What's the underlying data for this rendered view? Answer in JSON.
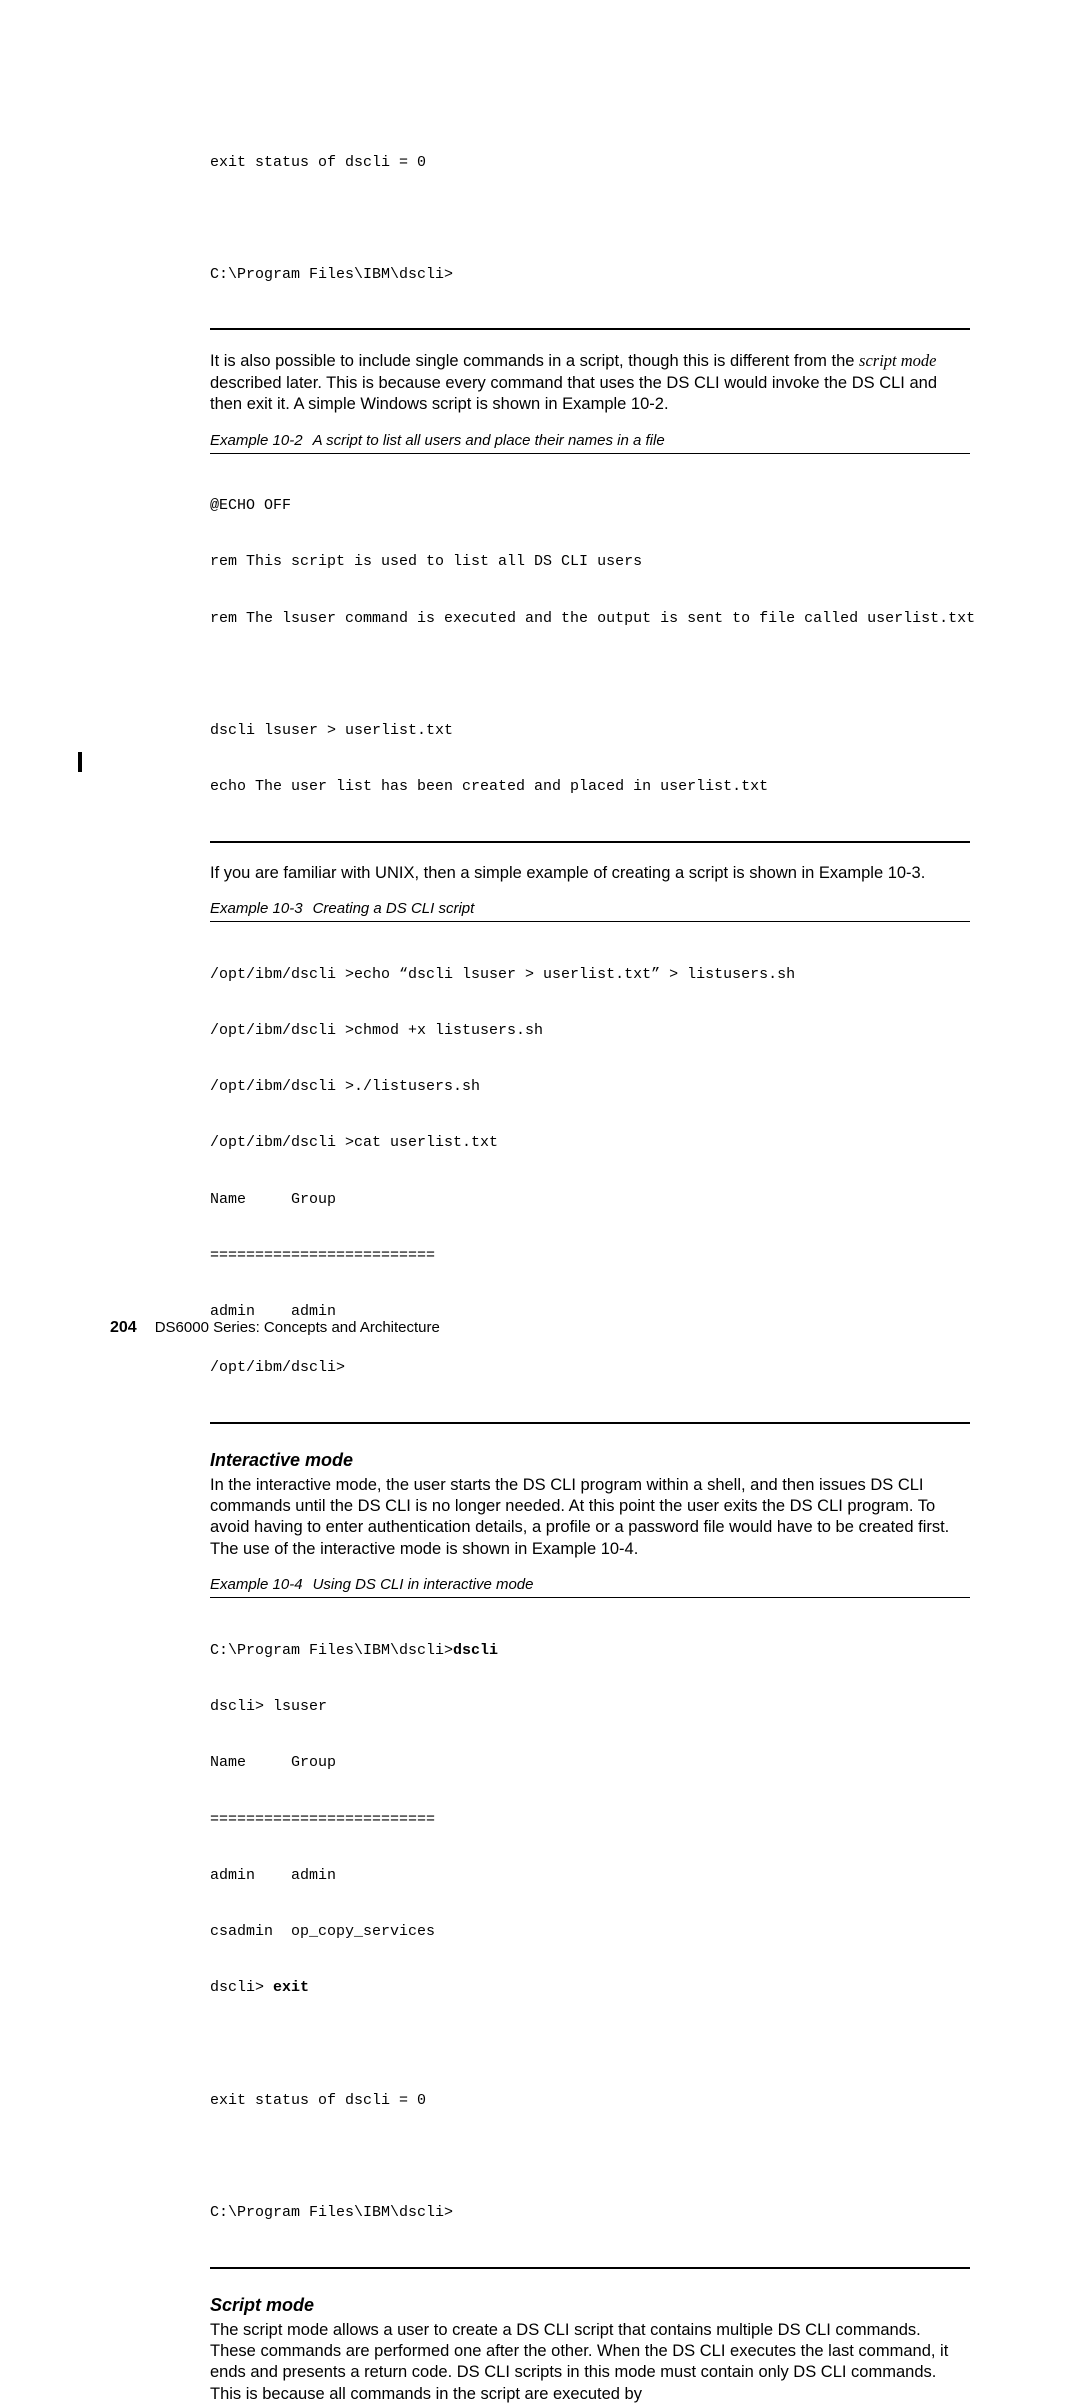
{
  "top_code": {
    "line1": "exit status of dscli = 0",
    "line2": "C:\\Program Files\\IBM\\dscli>"
  },
  "para1": {
    "pre": "It is also possible to include single commands in a script, though this is different from the ",
    "italic": "script mode",
    "post": " described later. This is because every command that uses the DS CLI would invoke the DS CLI and then exit it. A simple Windows script is shown in Example 10-2."
  },
  "ex2": {
    "num": "Example 10-2",
    "title": "A script to list all users and place their names in a file",
    "l1": "@ECHO OFF",
    "l2": "rem This script is used to list all DS CLI users",
    "l3": "rem The lsuser command is executed and the output is sent to file called userlist.txt",
    "l4": "dscli lsuser > userlist.txt",
    "l5": "echo The user list has been created and placed in userlist.txt"
  },
  "para2": "If you are familiar with UNIX, then a simple example of creating a script is shown in Example 10-3.",
  "ex3": {
    "num": "Example 10-3",
    "title": "Creating a DS CLI script",
    "l1": "/opt/ibm/dscli >echo “dscli lsuser > userlist.txt” > listusers.sh",
    "l2": "/opt/ibm/dscli >chmod +x listusers.sh",
    "l3": "/opt/ibm/dscli >./listusers.sh",
    "l4": "/opt/ibm/dscli >cat userlist.txt",
    "l5": "Name     Group",
    "l6": "=========================",
    "l7": "admin    admin",
    "l8": "/opt/ibm/dscli>"
  },
  "interactive": {
    "heading": "Interactive mode",
    "para": "In the interactive mode, the user starts the DS CLI program within a shell, and then issues DS CLI commands until the DS CLI is no longer needed. At this point the user exits the DS CLI program. To avoid having to enter authentication details, a profile or a password file would have to be created first. The use of the interactive mode is shown in Example 10-4."
  },
  "ex4": {
    "num": "Example 10-4",
    "title": "Using DS CLI in interactive mode",
    "l1a": "C:\\Program Files\\IBM\\dscli>",
    "l1b": "dscli",
    "l2": "dscli> lsuser",
    "l3": "Name     Group",
    "l4": "=========================",
    "l5": "admin    admin",
    "l6": "csadmin  op_copy_services",
    "l7a": "dscli> ",
    "l7b": "exit",
    "l8": "exit status of dscli = 0",
    "l9": "C:\\Program Files\\IBM\\dscli>"
  },
  "script_mode": {
    "heading": "Script mode",
    "para": "The script mode allows a user to create a DS CLI script that contains multiple DS CLI commands. These commands are performed one after the other. When the DS CLI executes the last command, it ends and presents a return code. DS CLI scripts in this mode must contain only DS CLI commands. This is because all commands in the script are executed by"
  },
  "footer": {
    "page": "204",
    "title": "DS6000 Series: Concepts and Architecture"
  }
}
